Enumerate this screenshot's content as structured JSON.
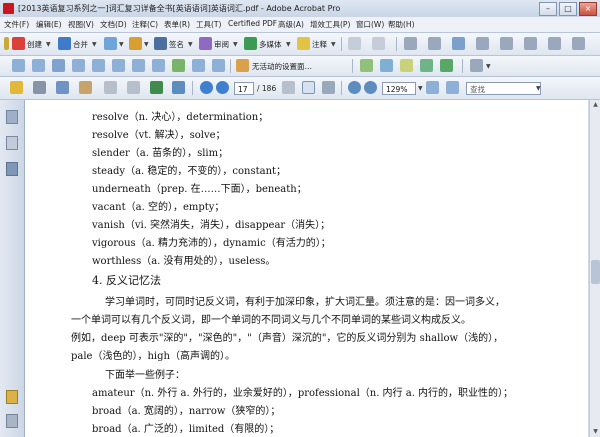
{
  "window": {
    "title": "[2013英语复习系列之一]词汇复习详备全书[英语语词]英语词汇.pdf - Adobe Acrobat Pro",
    "min": "–",
    "max": "□",
    "close": "×"
  },
  "menu": [
    "文件(F)",
    "编辑(E)",
    "视图(V)",
    "文档(D)",
    "注释(C)",
    "表单(R)",
    "工具(T)",
    "Certified PDF",
    "高级(A)",
    "增效工具(P)",
    "窗口(W)",
    "帮助(H)"
  ],
  "toolbar1": {
    "create": "创建",
    "combine": "合并",
    "sign": "签名",
    "collaborate": "审阅",
    "multimedia": "多媒体",
    "comment": "注释"
  },
  "toolbar2": {
    "unprocessed": "无活动的设置面…"
  },
  "toolbar3": {
    "page_current": "17",
    "page_total": "/ 186",
    "zoom": "129%",
    "search_placeholder": "查找"
  },
  "document": {
    "entries": [
      "resolve（n. 决心），determination；",
      "resolve（vt. 解决），solve；",
      "slender（a. 苗条的），slim；",
      "steady（a. 稳定的，不变的），constant；",
      "underneath（prep. 在……下面），beneath；",
      "vacant（a. 空的），empty；",
      "vanish（vi. 突然消失，消失），disappear（消失）；",
      "vigorous（a. 精力充沛的），dynamic（有活力的）；",
      "worthless（a. 没有用处的），useless。"
    ],
    "heading": "4. 反义记忆法",
    "para": [
      "学习单词时，可同时记反义词，有利于加深印象，扩大词汇量。须注意的是：因一词多义，",
      "一个单词可以有几个反义词，即一个单词的不同词义与几个不同单词的某些词义构成反义。",
      "例如，deep 可表示\"深的\"，\"深色的\"，\"（声音）深沉的\"，它的反义词分别为 shallow（浅的），",
      "pale（浅色的），high（高声调的）。"
    ],
    "intro": "下面举一些例子：",
    "examples": [
      "amateur（n. 外行 a. 外行的，业余爱好的），professional（n. 内行 a. 内行的，职业性的）；",
      "broad（a. 宽阔的），narrow（狭窄的）；",
      "broad（a. 广泛的），limited（有限的）；"
    ]
  }
}
